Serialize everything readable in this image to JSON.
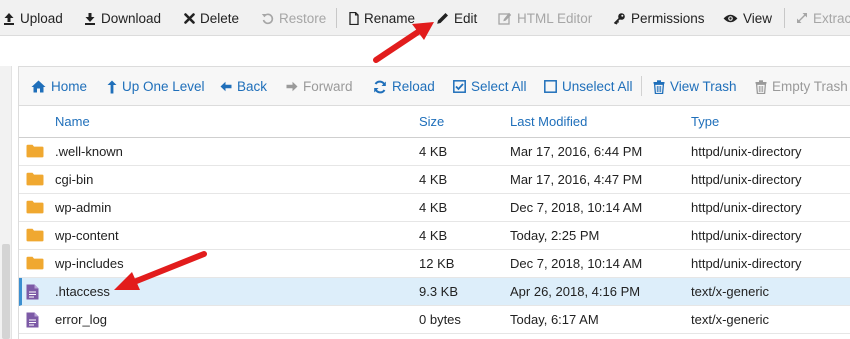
{
  "toolbar": {
    "items": [
      {
        "label": "Upload",
        "icon": "upload-icon",
        "enabled": true
      },
      {
        "label": "Download",
        "icon": "download-icon",
        "enabled": true
      },
      {
        "label": "Delete",
        "icon": "delete-icon",
        "enabled": true
      },
      {
        "label": "Restore",
        "icon": "restore-icon",
        "enabled": false
      },
      {
        "label": "Rename",
        "icon": "rename-icon",
        "enabled": true
      },
      {
        "label": "Edit",
        "icon": "pencil-icon",
        "enabled": true
      },
      {
        "label": "HTML Editor",
        "icon": "html-editor-icon",
        "enabled": false
      },
      {
        "label": "Permissions",
        "icon": "key-icon",
        "enabled": true
      },
      {
        "label": "View",
        "icon": "eye-icon",
        "enabled": true
      },
      {
        "label": "Extrac",
        "icon": "expand-icon",
        "enabled": false
      }
    ]
  },
  "nav": {
    "items": [
      {
        "label": "Home",
        "icon": "home-icon",
        "enabled": true
      },
      {
        "label": "Up One Level",
        "icon": "up-arrow-icon",
        "enabled": true
      },
      {
        "label": "Back",
        "icon": "back-arrow-icon",
        "enabled": true
      },
      {
        "label": "Forward",
        "icon": "forward-arrow-icon",
        "enabled": false
      },
      {
        "label": "Reload",
        "icon": "reload-icon",
        "enabled": true
      },
      {
        "label": "Select All",
        "icon": "checked-box-icon",
        "enabled": true
      },
      {
        "label": "Unselect All",
        "icon": "empty-box-icon",
        "enabled": true
      },
      {
        "label": "View Trash",
        "icon": "trash-icon",
        "enabled": true
      },
      {
        "label": "Empty Trash",
        "icon": "trash-icon",
        "enabled": false
      }
    ]
  },
  "table": {
    "columns": [
      "Name",
      "Size",
      "Last Modified",
      "Type"
    ],
    "rows": [
      {
        "name": ".well-known",
        "size": "4 KB",
        "modified": "Mar 17, 2016, 6:44 PM",
        "type": "httpd/unix-directory",
        "icon": "folder-icon",
        "selected": false
      },
      {
        "name": "cgi-bin",
        "size": "4 KB",
        "modified": "Mar 17, 2016, 4:47 PM",
        "type": "httpd/unix-directory",
        "icon": "folder-icon",
        "selected": false
      },
      {
        "name": "wp-admin",
        "size": "4 KB",
        "modified": "Dec 7, 2018, 10:14 AM",
        "type": "httpd/unix-directory",
        "icon": "folder-icon",
        "selected": false
      },
      {
        "name": "wp-content",
        "size": "4 KB",
        "modified": "Today, 2:25 PM",
        "type": "httpd/unix-directory",
        "icon": "folder-icon",
        "selected": false
      },
      {
        "name": "wp-includes",
        "size": "12 KB",
        "modified": "Dec 7, 2018, 10:14 AM",
        "type": "httpd/unix-directory",
        "icon": "folder-icon",
        "selected": false
      },
      {
        "name": ".htaccess",
        "size": "9.3 KB",
        "modified": "Apr 26, 2018, 4:16 PM",
        "type": "text/x-generic",
        "icon": "file-icon",
        "selected": true
      },
      {
        "name": "error_log",
        "size": "0 bytes",
        "modified": "Today, 6:17 AM",
        "type": "text/x-generic",
        "icon": "file-icon",
        "selected": false
      }
    ]
  },
  "colors": {
    "link_blue": "#1f6fba",
    "selected_row": "#ddeefa",
    "folder": "#f0a830",
    "file": "#7c5aa6",
    "annotation_arrow": "#e21c1c"
  }
}
